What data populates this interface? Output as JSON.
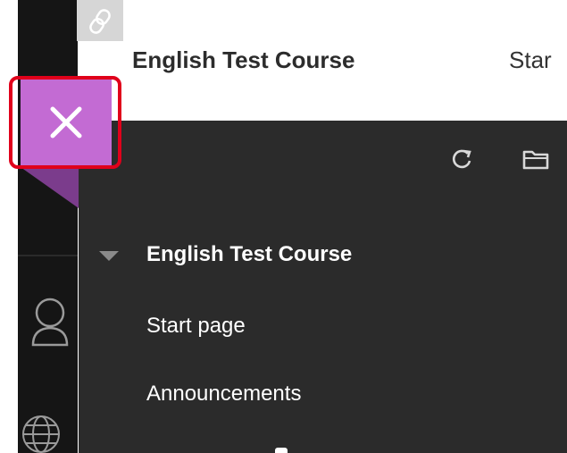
{
  "header": {
    "title": "English Test Course",
    "tab_partial": "Star"
  },
  "icons": {
    "link": "link-icon",
    "close": "close-icon",
    "refresh": "refresh-icon",
    "folder": "folder-icon",
    "user": "user-icon",
    "globe": "globe-icon",
    "collapse": "triangle-down-icon"
  },
  "colors": {
    "accent": "#c36bd3",
    "highlight_outline": "#e0001b",
    "panel_bg": "#2b2b2b",
    "nav_bg": "#151515"
  },
  "course_menu": {
    "items": [
      {
        "label": "English Test Course",
        "bold": true
      },
      {
        "label": "Start page",
        "bold": false
      },
      {
        "label": "Announcements",
        "bold": false
      }
    ]
  }
}
